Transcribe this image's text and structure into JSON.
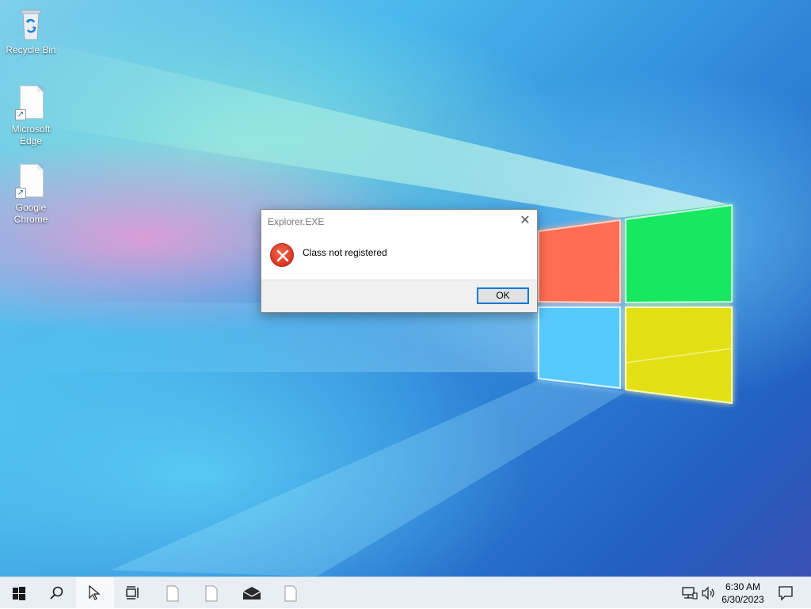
{
  "desktop": {
    "icons": [
      {
        "label": "Recycle Bin",
        "icon": "recycle-bin-icon"
      },
      {
        "label": "Microsoft Edge",
        "icon": "file-shortcut-icon"
      },
      {
        "label": "Google Chrome",
        "icon": "file-shortcut-icon"
      }
    ]
  },
  "dialog": {
    "title": "Explorer.EXE",
    "close_glyph": "✕",
    "message": "Class not registered",
    "ok_label": "OK",
    "icon": "error-icon"
  },
  "taskbar": {
    "buttons": [
      {
        "name": "start",
        "icon": "windows-start-icon"
      },
      {
        "name": "search",
        "icon": "search-icon"
      },
      {
        "name": "cortana",
        "icon": "cursor-icon",
        "active": true
      },
      {
        "name": "task-view",
        "icon": "task-view-icon"
      },
      {
        "name": "app-1",
        "icon": "blank-file-icon"
      },
      {
        "name": "app-2",
        "icon": "blank-file-icon"
      },
      {
        "name": "mail",
        "icon": "mail-icon"
      },
      {
        "name": "app-3",
        "icon": "blank-file-icon"
      }
    ],
    "tray": {
      "network_icon": "network-icon",
      "volume_icon": "volume-icon",
      "time": "6:30 AM",
      "date": "6/30/2023",
      "notification_icon": "notification-icon"
    }
  },
  "colors": {
    "accent": "#0078d7",
    "error_red": "#e0402a",
    "logo_red": "#ff6a4a",
    "logo_green": "#1fe85a",
    "logo_blue": "#5cc8ff",
    "logo_yellow": "#e8e31a"
  }
}
